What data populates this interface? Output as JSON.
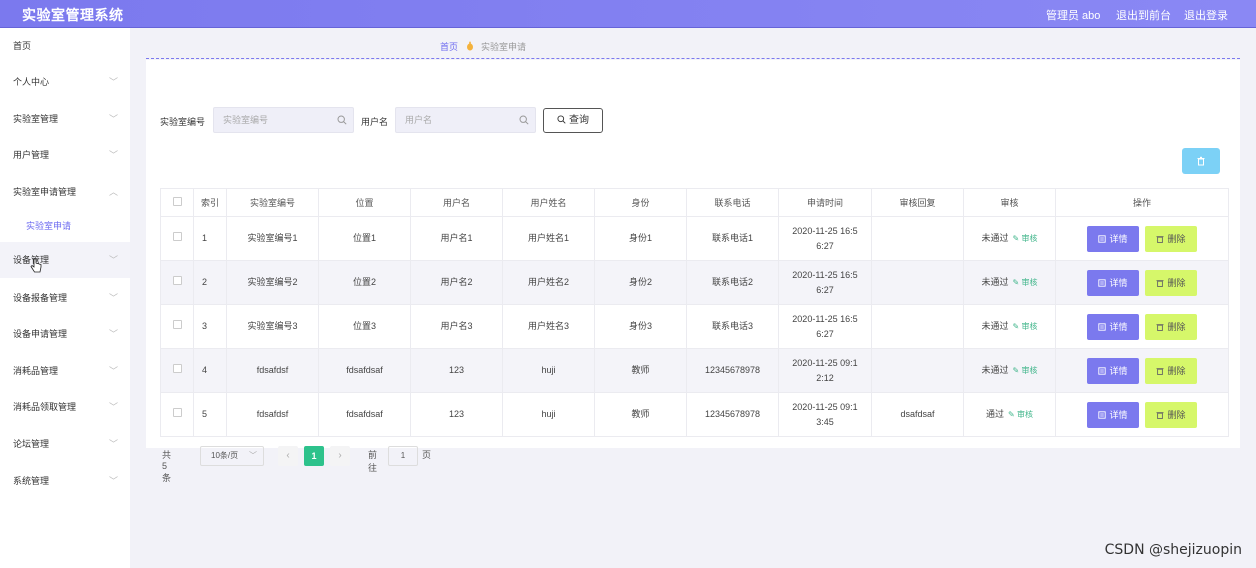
{
  "header": {
    "app_title": "实验室管理系统",
    "user_label": "管理员 abo",
    "back_front_label": "退出到前台",
    "logout_label": "退出登录",
    "color": "#7b79ee"
  },
  "sidebar": {
    "items": [
      {
        "label": "首页",
        "expandable": false
      },
      {
        "label": "个人中心",
        "expandable": true
      },
      {
        "label": "实验室管理",
        "expandable": true
      },
      {
        "label": "用户管理",
        "expandable": true
      },
      {
        "label": "实验室申请管理",
        "expandable": true,
        "expanded": true
      },
      {
        "label": "实验室申请",
        "expandable": false,
        "active": true
      },
      {
        "label": "设备管理",
        "expandable": true,
        "hovered": true
      },
      {
        "label": "设备报备管理",
        "expandable": true
      },
      {
        "label": "设备申请管理",
        "expandable": true
      },
      {
        "label": "消耗品管理",
        "expandable": true
      },
      {
        "label": "消耗品领取管理",
        "expandable": true
      },
      {
        "label": "论坛管理",
        "expandable": true
      },
      {
        "label": "系统管理",
        "expandable": true
      }
    ]
  },
  "breadcrumb": {
    "home": "首页",
    "current": "实验室申请"
  },
  "search": {
    "lab_label": "实验室编号",
    "lab_placeholder": "实验室编号",
    "user_label": "用户名",
    "user_placeholder": "用户名",
    "button_label": "查询"
  },
  "table": {
    "headers": [
      "",
      "索引",
      "实验室编号",
      "位置",
      "用户名",
      "用户姓名",
      "身份",
      "联系电话",
      "申请时间",
      "审核回复",
      "审核",
      "操作"
    ],
    "audit_link_label": "审核",
    "detail_label": "详情",
    "delete_label": "删除",
    "rows": [
      {
        "index": "1",
        "lab": "实验室编号1",
        "location": "位置1",
        "username": "用户名1",
        "name": "用户姓名1",
        "role": "身份1",
        "phone": "联系电话1",
        "time_line1": "2020-11-25 16:5",
        "time_line2": "6:27",
        "reply": "",
        "status": "未通过"
      },
      {
        "index": "2",
        "lab": "实验室编号2",
        "location": "位置2",
        "username": "用户名2",
        "name": "用户姓名2",
        "role": "身份2",
        "phone": "联系电话2",
        "time_line1": "2020-11-25 16:5",
        "time_line2": "6:27",
        "reply": "",
        "status": "未通过"
      },
      {
        "index": "3",
        "lab": "实验室编号3",
        "location": "位置3",
        "username": "用户名3",
        "name": "用户姓名3",
        "role": "身份3",
        "phone": "联系电话3",
        "time_line1": "2020-11-25 16:5",
        "time_line2": "6:27",
        "reply": "",
        "status": "未通过"
      },
      {
        "index": "4",
        "lab": "fdsafdsf",
        "location": "fdsafdsaf",
        "username": "123",
        "name": "huji",
        "role": "教师",
        "phone": "12345678978",
        "time_line1": "2020-11-25 09:1",
        "time_line2": "2:12",
        "reply": "",
        "status": "未通过"
      },
      {
        "index": "5",
        "lab": "fdsafdsf",
        "location": "fdsafdsaf",
        "username": "123",
        "name": "huji",
        "role": "教师",
        "phone": "12345678978",
        "time_line1": "2020-11-25 09:1",
        "time_line2": "3:45",
        "reply": "dsafdsaf",
        "status": "通过"
      }
    ]
  },
  "pagination": {
    "total_label": "共 5 条",
    "page_size": "10条/页",
    "current_page": "1",
    "goto_prefix": "前往",
    "goto_value": "1",
    "goto_suffix": "页"
  },
  "watermark": "CSDN @shejizuopin"
}
